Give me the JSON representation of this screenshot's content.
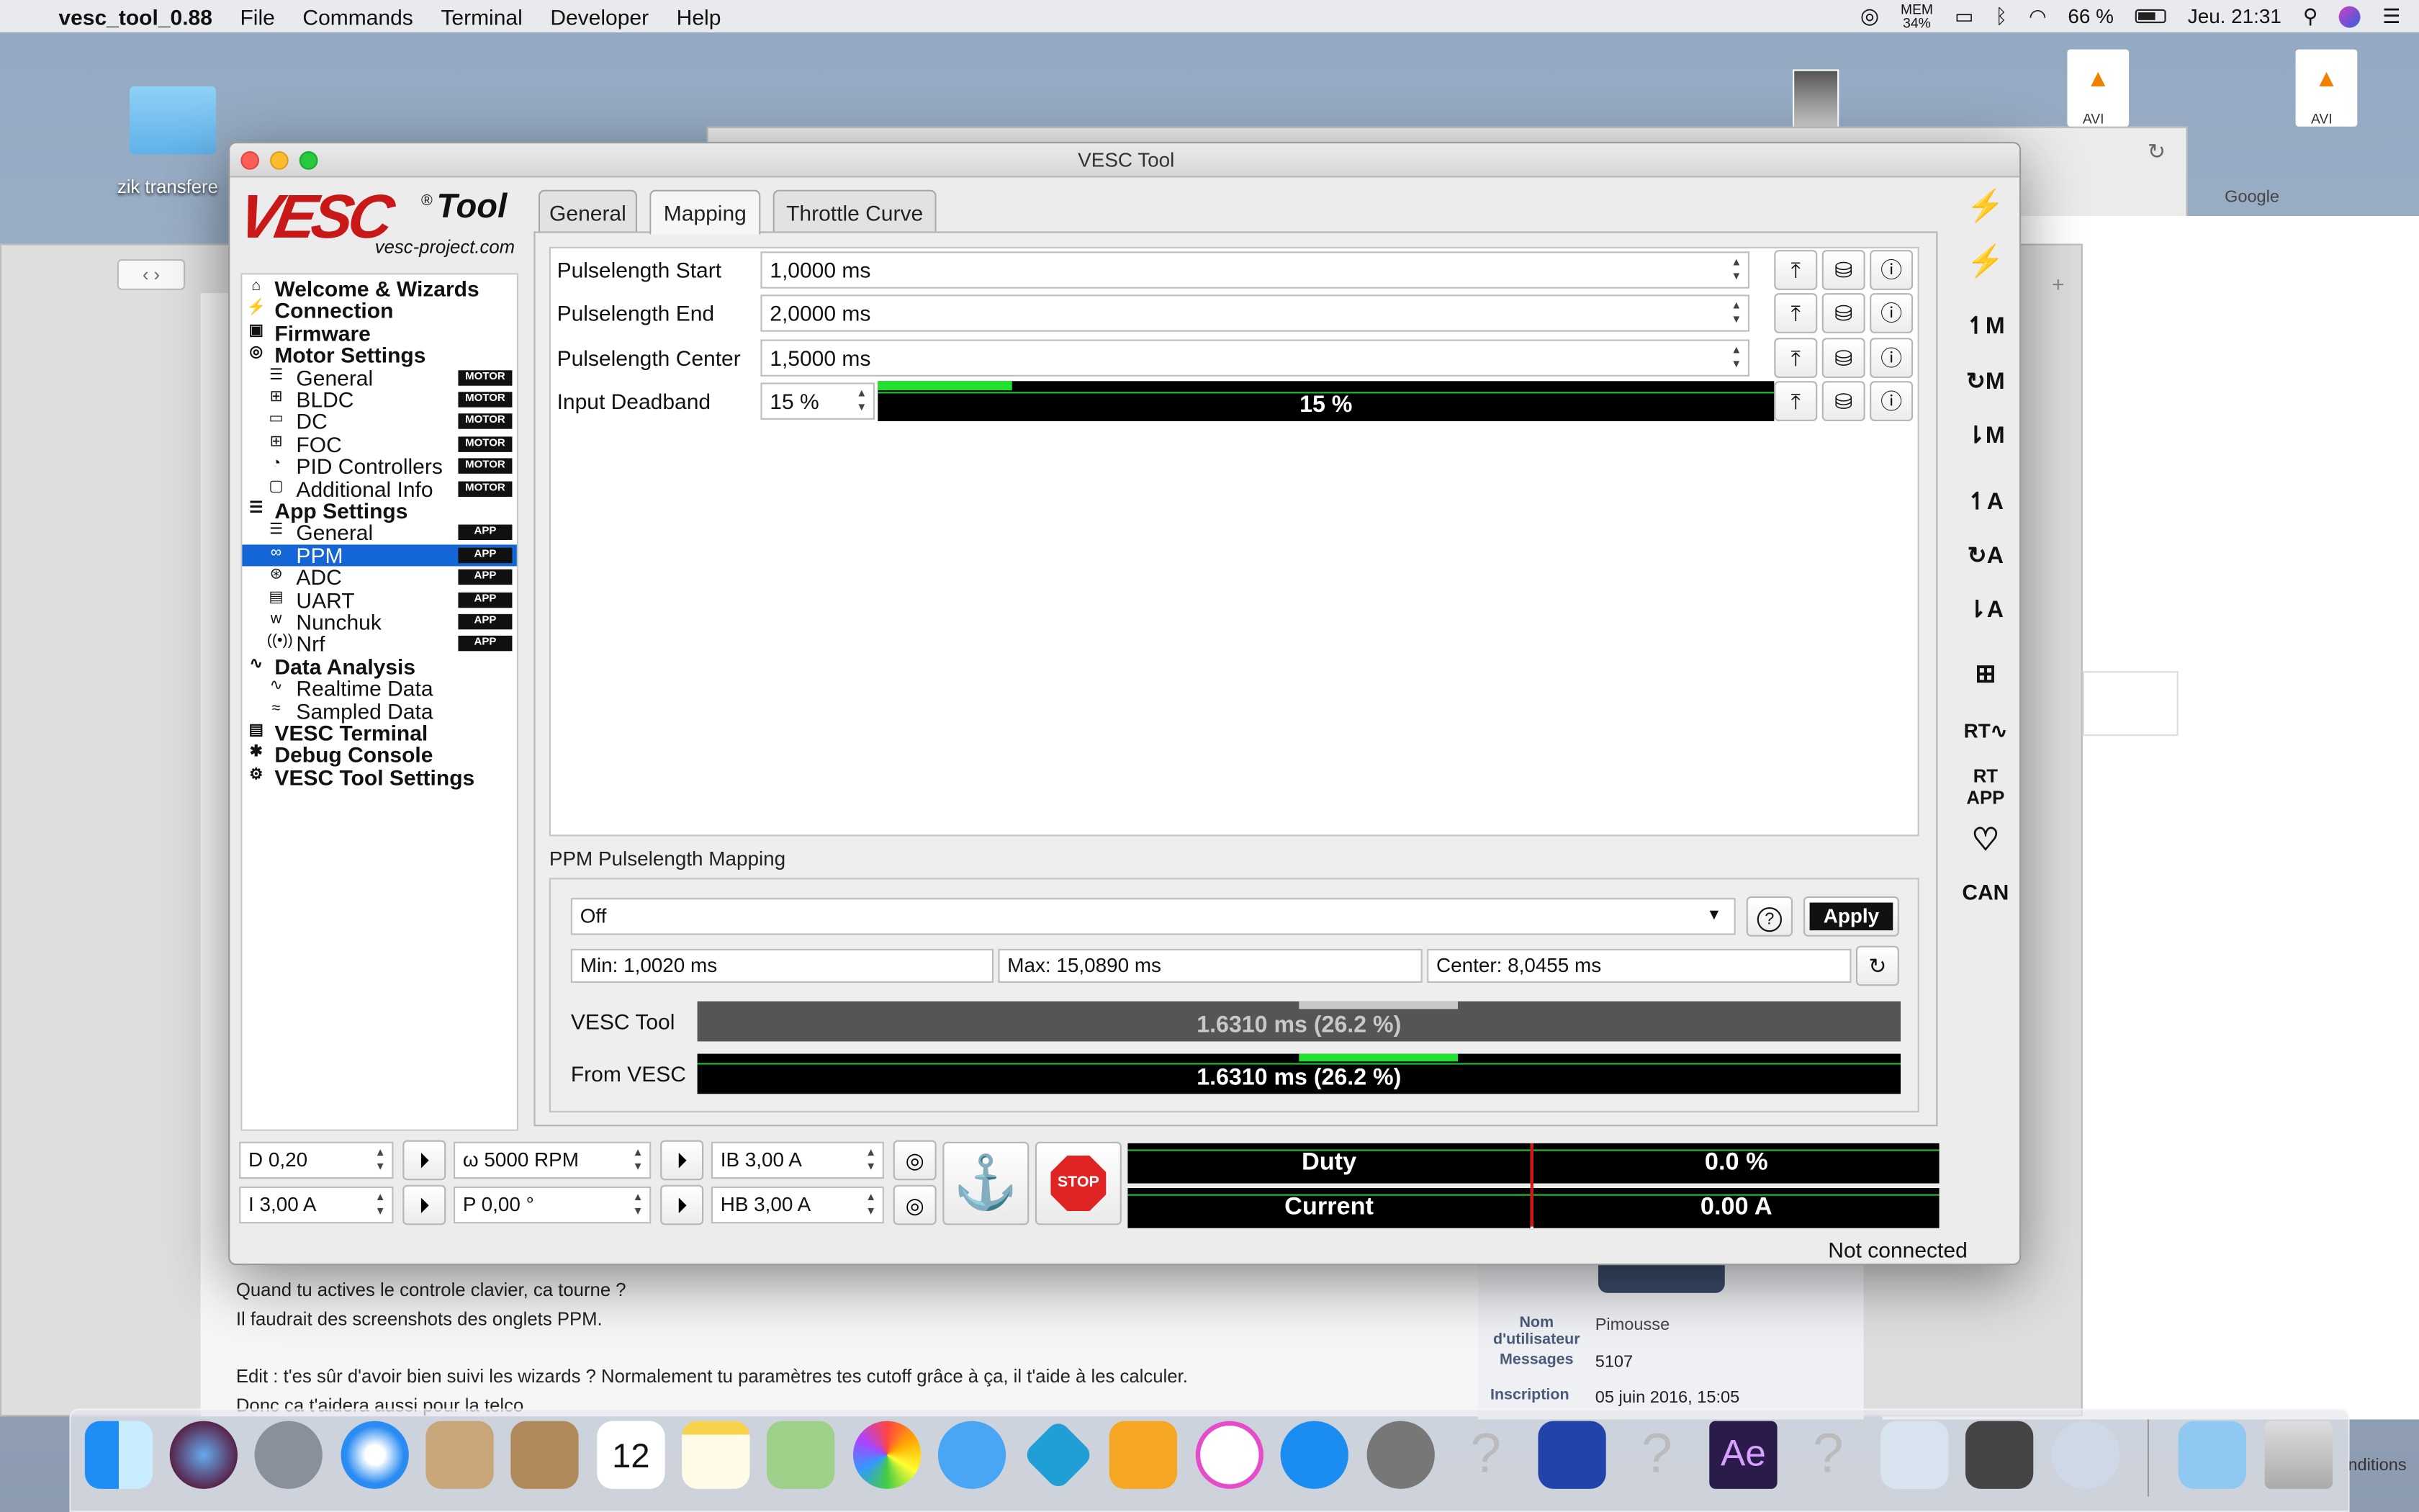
{
  "menubar": {
    "app_name": "vesc_tool_0.88",
    "items": [
      "File",
      "Commands",
      "Terminal",
      "Developer",
      "Help"
    ],
    "mem_label": "MEM",
    "mem_value": "34%",
    "battery": "66 %",
    "clock": "Jeu. 21:31"
  },
  "desktop": {
    "folder_label": "zik transfere",
    "file_labels": [
      "AVI",
      "AVI"
    ]
  },
  "background_window": {
    "google_label": "Google",
    "forum_lines": [
      "Quand tu actives le controle clavier, ca tourne ?",
      "Il faudrait des screenshots des onglets PPM.",
      "Edit : t'es sûr d'avoir bien suivi les wizards ? Normalement tu paramètres tes cutoff grâce à ça, il t'aide à les calculer.",
      "Donc ca t'aidera aussi pour la telco"
    ],
    "profile": {
      "name_label": "Nom d'utilisateur",
      "name_value": "Pimousse",
      "messages_label": "Messages",
      "messages_value": "5107",
      "inscription_label": "Inscription",
      "inscription_value": "05 juin 2016, 15:05"
    },
    "conditions": "nditions"
  },
  "window": {
    "title": "VESC Tool",
    "logo_text": "VESC",
    "logo_tool": "Tool",
    "logo_url": "vesc-project.com",
    "status": "Not connected"
  },
  "tree": [
    {
      "label": "Welcome & Wizards",
      "level": 0,
      "icon": "home-icon"
    },
    {
      "label": "Connection",
      "level": 0,
      "icon": "plug-icon"
    },
    {
      "label": "Firmware",
      "level": 0,
      "icon": "chip-icon"
    },
    {
      "label": "Motor Settings",
      "level": 0,
      "icon": "motor-icon"
    },
    {
      "label": "General",
      "level": 1,
      "icon": "sliders-icon",
      "badge": "MOTOR"
    },
    {
      "label": "BLDC",
      "level": 1,
      "icon": "bldc-icon",
      "badge": "MOTOR"
    },
    {
      "label": "DC",
      "level": 1,
      "icon": "battery-icon",
      "badge": "MOTOR"
    },
    {
      "label": "FOC",
      "level": 1,
      "icon": "foc-icon",
      "badge": "MOTOR"
    },
    {
      "label": "PID Controllers",
      "level": 1,
      "icon": "gauge-icon",
      "badge": "MOTOR"
    },
    {
      "label": "Additional Info",
      "level": 1,
      "icon": "info-icon",
      "badge": "MOTOR"
    },
    {
      "label": "App Settings",
      "level": 0,
      "icon": "app-sliders-icon"
    },
    {
      "label": "General",
      "level": 1,
      "icon": "sliders-icon",
      "badge": "APP"
    },
    {
      "label": "PPM",
      "level": 1,
      "icon": "ppm-icon",
      "badge": "APP",
      "selected": true
    },
    {
      "label": "ADC",
      "level": 1,
      "icon": "adc-icon",
      "badge": "APP"
    },
    {
      "label": "UART",
      "level": 1,
      "icon": "uart-icon",
      "badge": "APP"
    },
    {
      "label": "Nunchuk",
      "level": 1,
      "icon": "wii-icon",
      "badge": "APP"
    },
    {
      "label": "Nrf",
      "level": 1,
      "icon": "wireless-icon",
      "badge": "APP"
    },
    {
      "label": "Data Analysis",
      "level": 0,
      "icon": "chart-icon"
    },
    {
      "label": "Realtime Data",
      "level": 1,
      "icon": "realtime-icon"
    },
    {
      "label": "Sampled Data",
      "level": 1,
      "icon": "sampled-icon"
    },
    {
      "label": "VESC Terminal",
      "level": 0,
      "icon": "terminal-icon"
    },
    {
      "label": "Debug Console",
      "level": 0,
      "icon": "bug-icon"
    },
    {
      "label": "VESC Tool Settings",
      "level": 0,
      "icon": "gear-icon"
    }
  ],
  "tabs": [
    "General",
    "Mapping",
    "Throttle Curve"
  ],
  "active_tab": "Mapping",
  "params": [
    {
      "label": "Pulselength Start",
      "value": "1,0000 ms"
    },
    {
      "label": "Pulselength End",
      "value": "2,0000 ms"
    },
    {
      "label": "Pulselength Center",
      "value": "1,5000 ms"
    }
  ],
  "deadband": {
    "label": "Input Deadband",
    "value": "15 %",
    "bar_text": "15 %",
    "fraction": 0.15
  },
  "mapping": {
    "title": "PPM Pulselength Mapping",
    "mode": "Off",
    "apply_label": "Apply",
    "help_label": "?",
    "min": "Min: 1,0020 ms",
    "max": "Max: 15,0890 ms",
    "center": "Center: 8,0455 ms",
    "vesc_tool_label": "VESC Tool",
    "vesc_tool_value": "1.6310 ms (26.2 %)",
    "from_vesc_label": "From VESC",
    "from_vesc_value": "1.6310 ms (26.2 %)",
    "fraction": 0.262
  },
  "toolbar": {
    "duty": "D 0,20",
    "current": "I 3,00 A",
    "rpm": "ω 5000 RPM",
    "position": "P 0,00 °",
    "brake_current": "IB 3,00 A",
    "handbrake": "HB 3,00 A",
    "stop_label": "STOP",
    "duty_label": "Duty",
    "duty_value": "0.0 %",
    "current_label": "Current",
    "current_value": "0.00 A"
  },
  "right_toolbar": [
    "↿M",
    "↻M",
    "⇂M",
    "↿A",
    "↻A",
    "⇂A",
    "CAN"
  ],
  "colors": {
    "accent": "#1466d6",
    "bar_green": "#22e030",
    "stop_red": "#e02424"
  }
}
